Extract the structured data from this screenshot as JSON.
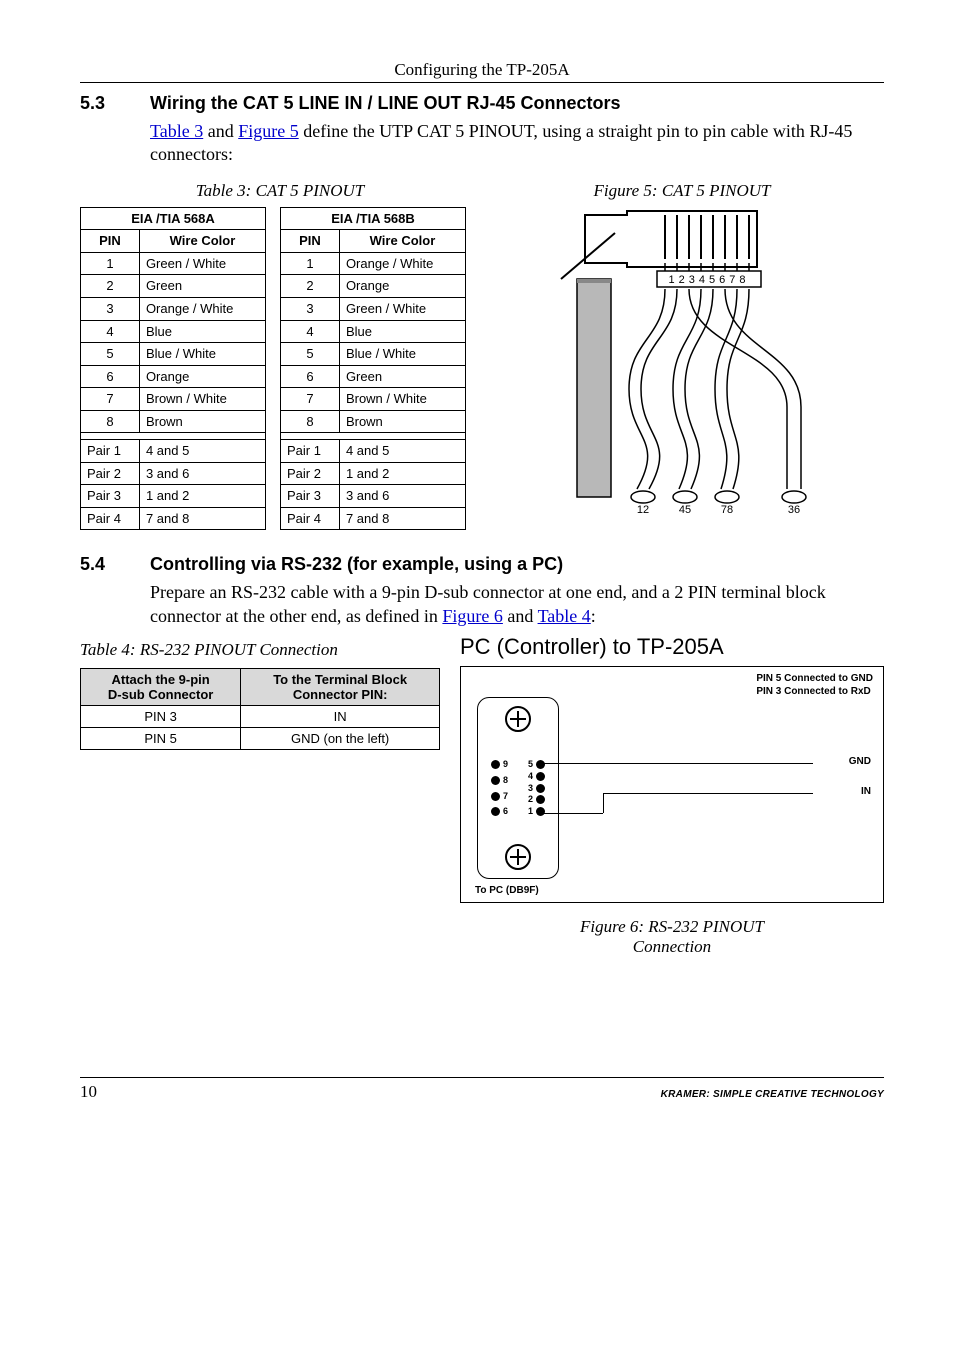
{
  "running_head": "Configuring the TP-205A",
  "sec53": {
    "num": "5.3",
    "title": "Wiring the CAT 5 LINE IN / LINE OUT RJ-45 Connectors",
    "para_pre": " and ",
    "para_post": " define the UTP CAT 5 PINOUT, using a straight pin to pin cable with RJ-45 connectors:",
    "link1": "Table 3",
    "link2": "Figure 5"
  },
  "table3_caption": "Table 3: CAT 5 PINOUT",
  "figure5_caption": "Figure 5: CAT 5 PINOUT",
  "t568a": {
    "title": "EIA /TIA 568A",
    "h1": "PIN",
    "h2": "Wire Color",
    "rows": [
      {
        "p": "1",
        "c": "Green / White"
      },
      {
        "p": "2",
        "c": "Green"
      },
      {
        "p": "3",
        "c": "Orange / White"
      },
      {
        "p": "4",
        "c": "Blue"
      },
      {
        "p": "5",
        "c": "Blue / White"
      },
      {
        "p": "6",
        "c": "Orange"
      },
      {
        "p": "7",
        "c": "Brown / White"
      },
      {
        "p": "8",
        "c": "Brown"
      }
    ],
    "pairs": [
      {
        "p": "Pair 1",
        "c": "4 and 5"
      },
      {
        "p": "Pair 2",
        "c": "3 and 6"
      },
      {
        "p": "Pair 3",
        "c": "1 and 2"
      },
      {
        "p": "Pair 4",
        "c": "7 and 8"
      }
    ]
  },
  "t568b": {
    "title": "EIA /TIA 568B",
    "h1": "PIN",
    "h2": "Wire Color",
    "rows": [
      {
        "p": "1",
        "c": "Orange / White"
      },
      {
        "p": "2",
        "c": "Orange"
      },
      {
        "p": "3",
        "c": "Green / White"
      },
      {
        "p": "4",
        "c": "Blue"
      },
      {
        "p": "5",
        "c": "Blue / White"
      },
      {
        "p": "6",
        "c": "Green"
      },
      {
        "p": "7",
        "c": "Brown / White"
      },
      {
        "p": "8",
        "c": "Brown"
      }
    ],
    "pairs": [
      {
        "p": "Pair 1",
        "c": "4 and 5"
      },
      {
        "p": "Pair 2",
        "c": "1 and 2"
      },
      {
        "p": "Pair 3",
        "c": "3 and 6"
      },
      {
        "p": "Pair 4",
        "c": "7 and 8"
      }
    ]
  },
  "rj45": {
    "digits": "12345678",
    "bottom": [
      "12",
      "45",
      "78",
      "36"
    ]
  },
  "sec54": {
    "num": "5.4",
    "title": "Controlling via RS-232 (for example, using a PC)",
    "para1": "Prepare an RS-232 cable with a 9-pin D-sub connector at one end, and a 2 PIN terminal block connector at the other end, as defined in ",
    "link1": "Figure 6",
    "para_mid": " and ",
    "link2": "Table 4",
    "para_end": ":"
  },
  "table4_caption": "Table 4: RS-232 PINOUT Connection",
  "table4": {
    "h1a": "Attach the 9-pin",
    "h1b": "D-sub Connector",
    "h2a": "To the Terminal Block",
    "h2b": "Connector PIN:",
    "rows": [
      {
        "a": "PIN 3",
        "b": "IN"
      },
      {
        "a": "PIN 5",
        "b": "GND (on the left)"
      }
    ]
  },
  "pcfig": {
    "title": "PC (Controller) to TP-205A",
    "note1": "PIN 5 Connected to GND",
    "note2": "PIN 3 Connected to RxD",
    "gnd": "GND",
    "in": "IN",
    "topc": "To PC (DB9F)",
    "pins_right": [
      "5",
      "4",
      "3",
      "2",
      "1"
    ],
    "pins_left": [
      "9",
      "8",
      "7",
      "6"
    ]
  },
  "figure6_caption_a": "Figure 6: RS-232 PINOUT",
  "figure6_caption_b": "Connection",
  "footer": {
    "page": "10",
    "tag": "KRAMER:  SIMPLE CREATIVE TECHNOLOGY"
  }
}
